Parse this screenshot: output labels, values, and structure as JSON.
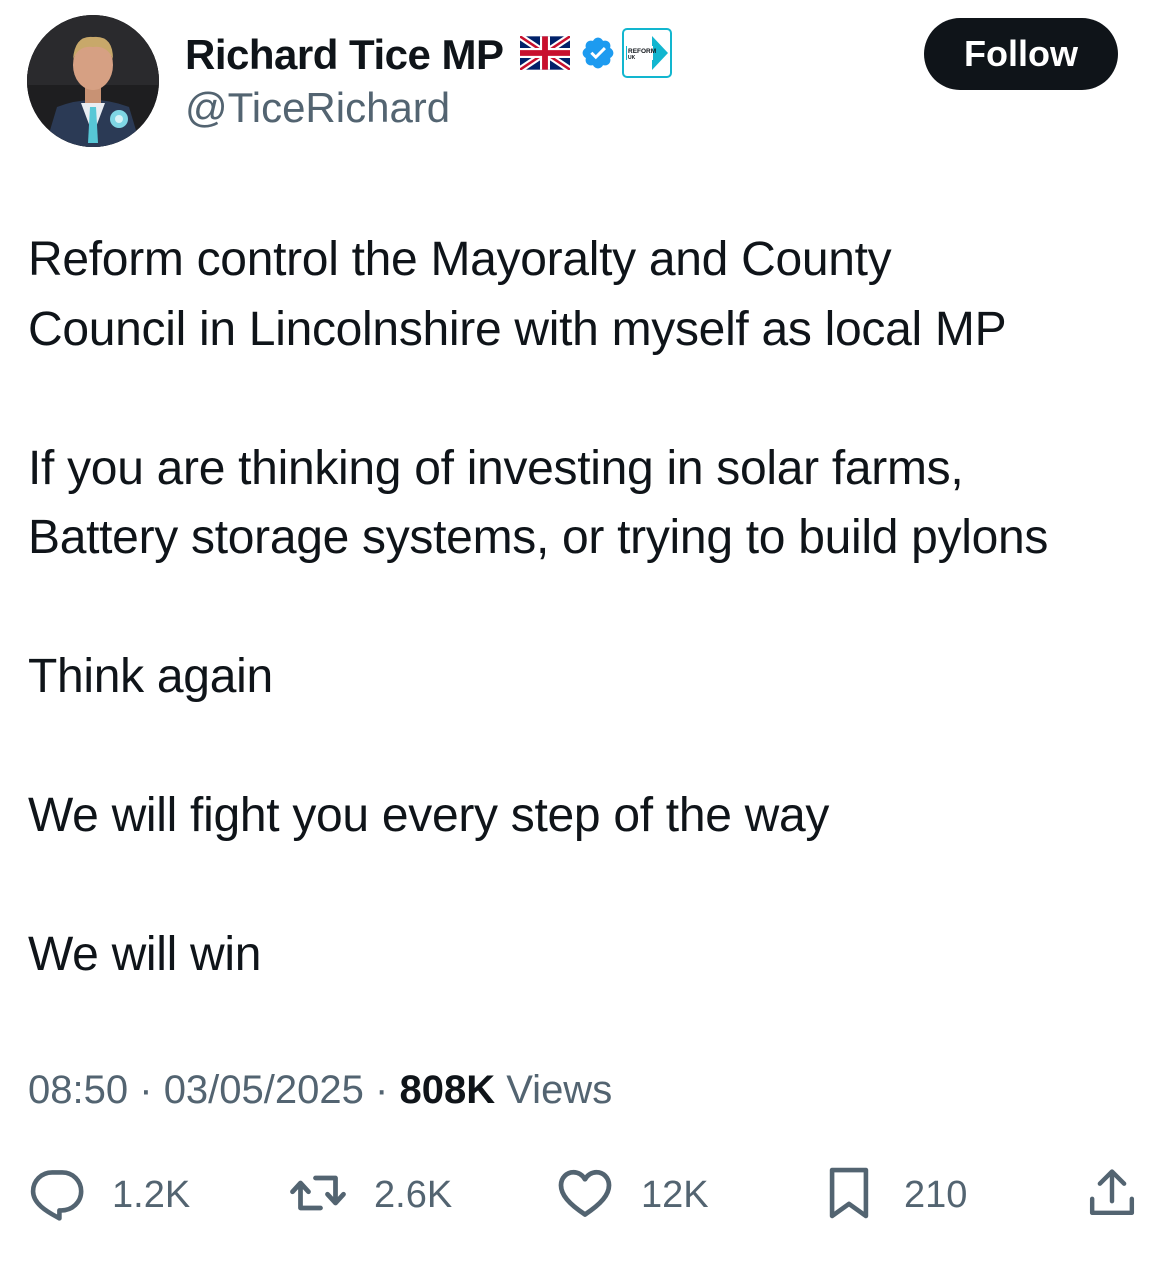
{
  "author": {
    "display_name": "Richard Tice MP",
    "handle": "@TiceRichard",
    "badges": [
      "uk-flag-icon",
      "verified-badge-icon",
      "reform-uk-badge-icon"
    ],
    "party_badge_text": [
      "REFORM",
      "UK"
    ]
  },
  "follow_label": "Follow",
  "tweet": {
    "lines": [
      "Reform control the Mayoralty and County",
      "Council in Lincolnshire with myself as local MP",
      "If you are thinking of investing in solar farms,",
      "Battery storage systems, or trying to build pylons",
      "Think again",
      "We will fight you every step of the way",
      "We will win"
    ]
  },
  "meta": {
    "time": "08:50",
    "separator": "·",
    "date": "03/05/2025",
    "views_count": "808K",
    "views_label": "Views"
  },
  "actions": {
    "replies": {
      "icon": "reply-icon",
      "count": "1.2K"
    },
    "reposts": {
      "icon": "repost-icon",
      "count": "2.6K"
    },
    "likes": {
      "icon": "like-icon",
      "count": "12K"
    },
    "bookmarks": {
      "icon": "bookmark-icon",
      "count": "210"
    },
    "share": {
      "icon": "share-icon"
    }
  },
  "colors": {
    "text_primary": "#0f1419",
    "text_secondary": "#536471",
    "follow_bg": "#0f1419",
    "verified_blue": "#1d9bf0",
    "reform_cyan": "#12b6cf"
  }
}
